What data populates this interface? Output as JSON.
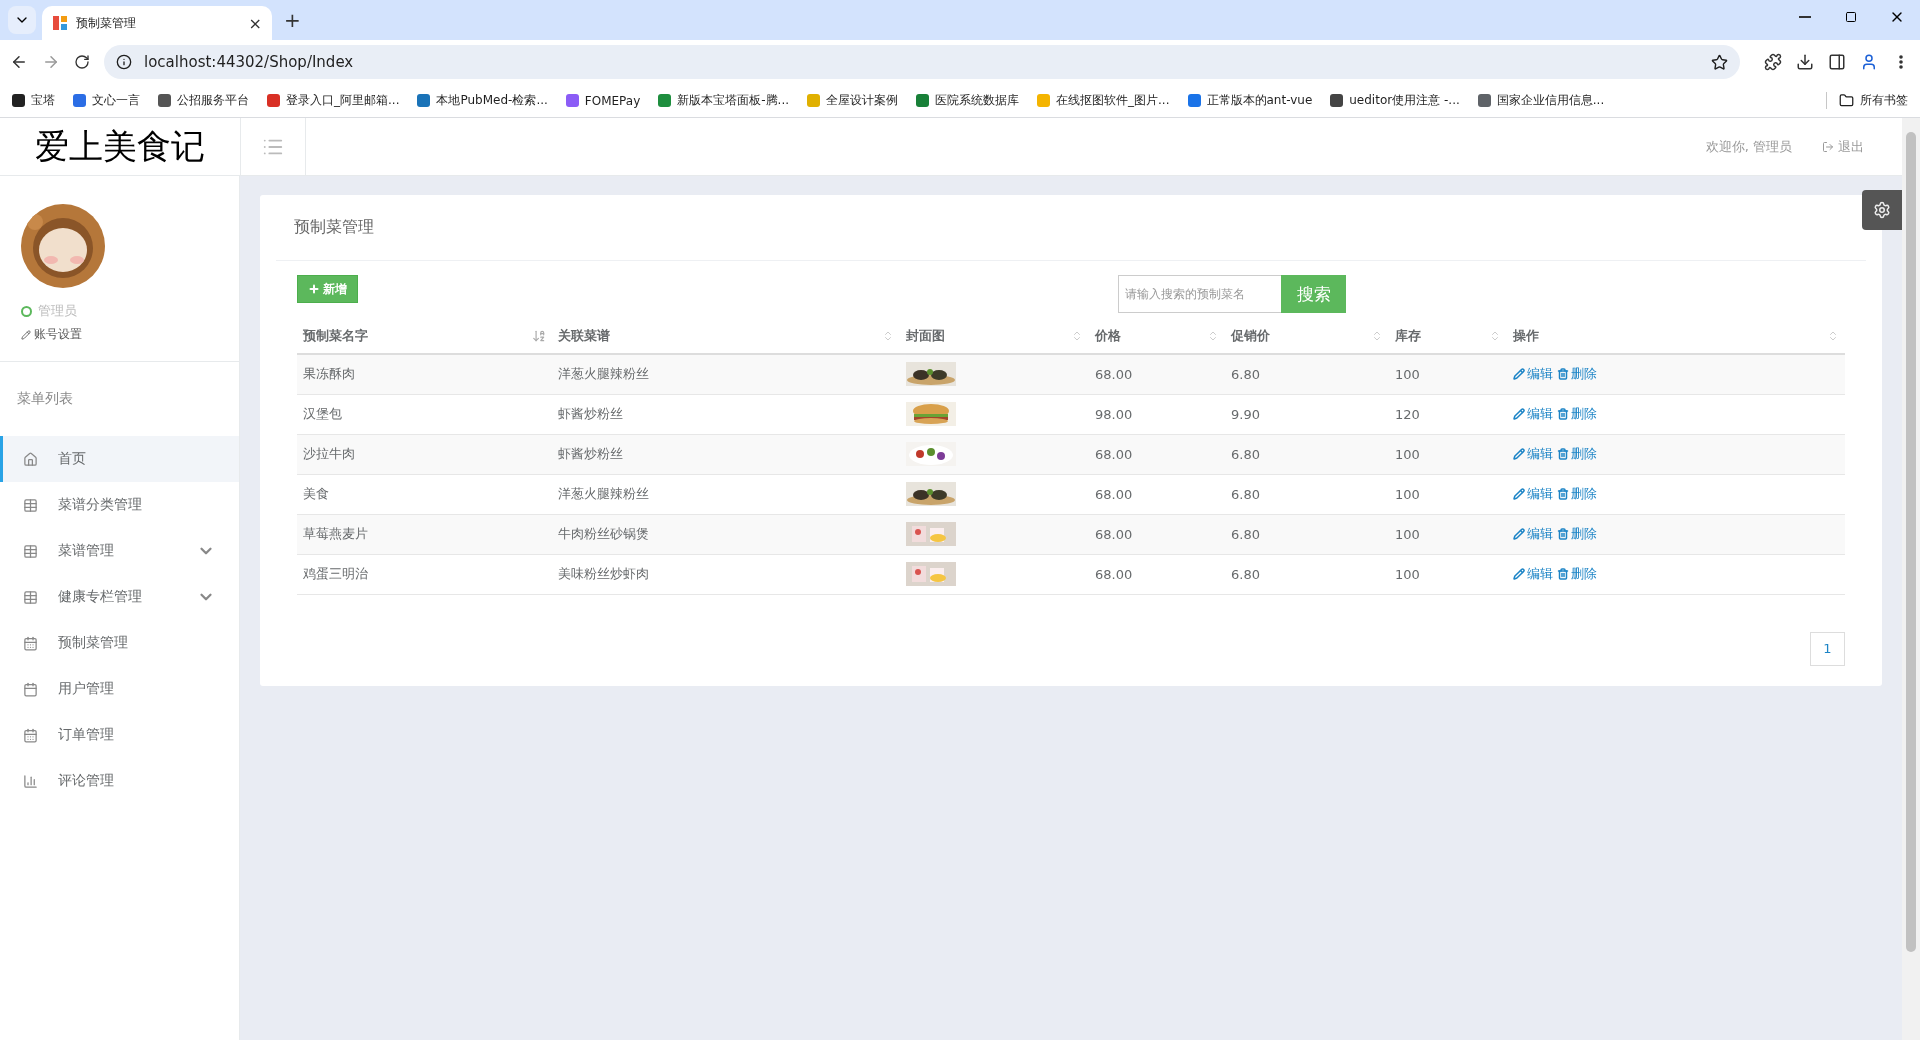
{
  "browser": {
    "tab": {
      "title": "预制菜管理",
      "close": "×"
    },
    "new_tab": "+",
    "url": "localhost:44302/Shop/Index",
    "bookmarks": [
      {
        "label": "宝塔",
        "color": "#222222"
      },
      {
        "label": "文心一言",
        "color": "#2b6de5"
      },
      {
        "label": "公招服务平台",
        "color": "#555555"
      },
      {
        "label": "登录入口_阿里邮箱...",
        "color": "#d93025"
      },
      {
        "label": "本地PubMed-检索...",
        "color": "#1a73b8"
      },
      {
        "label": "FOMEPay",
        "color": "#8b5cf6"
      },
      {
        "label": "新版本宝塔面板-腾...",
        "color": "#1e8e3e"
      },
      {
        "label": "全屋设计案例",
        "color": "#e0b000"
      },
      {
        "label": "医院系统数据库",
        "color": "#188038"
      },
      {
        "label": "在线抠图软件_图片...",
        "color": "#f4b400"
      },
      {
        "label": "正常版本的ant-vue",
        "color": "#1a73e8"
      },
      {
        "label": "ueditor使用注意 -...",
        "color": "#444444"
      },
      {
        "label": "国家企业信用信息...",
        "color": "#5f6368"
      }
    ],
    "all_bookmarks": "所有书签"
  },
  "app": {
    "logo": "爱上美食记",
    "welcome": "欢迎你, 管理员",
    "logout": "退出"
  },
  "profile": {
    "role": "管理员",
    "settings": "账号设置"
  },
  "sidebar": {
    "heading": "菜单列表",
    "items": [
      {
        "label": "首页",
        "selected": true,
        "expandable": false
      },
      {
        "label": "菜谱分类管理",
        "selected": false,
        "expandable": false
      },
      {
        "label": "菜谱管理",
        "selected": false,
        "expandable": true
      },
      {
        "label": "健康专栏管理",
        "selected": false,
        "expandable": true
      },
      {
        "label": "预制菜管理",
        "selected": false,
        "expandable": false
      },
      {
        "label": "用户管理",
        "selected": false,
        "expandable": false
      },
      {
        "label": "订单管理",
        "selected": false,
        "expandable": false
      },
      {
        "label": "评论管理",
        "selected": false,
        "expandable": false
      }
    ]
  },
  "panel": {
    "title": "预制菜管理",
    "add_button": "新增",
    "search": {
      "placeholder": "请输入搜索的预制菜名",
      "button": "搜索"
    }
  },
  "table": {
    "columns": [
      {
        "label": "预制菜名字",
        "sorted": true
      },
      {
        "label": "关联菜谱",
        "sorted": false
      },
      {
        "label": "封面图",
        "sorted": false
      },
      {
        "label": "价格",
        "sorted": false
      },
      {
        "label": "促销价",
        "sorted": false
      },
      {
        "label": "库存",
        "sorted": false
      },
      {
        "label": "操作",
        "sorted": false
      }
    ],
    "rows": [
      {
        "name": "果冻酥肉",
        "recipe": "洋葱火腿辣粉丝",
        "price": "68.00",
        "promo": "6.80",
        "stock": "100",
        "edit": "编辑",
        "delete": "删除"
      },
      {
        "name": "汉堡包",
        "recipe": "虾酱炒粉丝",
        "price": "98.00",
        "promo": "9.90",
        "stock": "120",
        "edit": "编辑",
        "delete": "删除"
      },
      {
        "name": "沙拉牛肉",
        "recipe": "虾酱炒粉丝",
        "price": "68.00",
        "promo": "6.80",
        "stock": "100",
        "edit": "编辑",
        "delete": "删除"
      },
      {
        "name": "美食",
        "recipe": "洋葱火腿辣粉丝",
        "price": "68.00",
        "promo": "6.80",
        "stock": "100",
        "edit": "编辑",
        "delete": "删除"
      },
      {
        "name": "草莓燕麦片",
        "recipe": "牛肉粉丝砂锅煲",
        "price": "68.00",
        "promo": "6.80",
        "stock": "100",
        "edit": "编辑",
        "delete": "删除"
      },
      {
        "name": "鸡蛋三明治",
        "recipe": "美味粉丝炒虾肉",
        "price": "68.00",
        "promo": "6.80",
        "stock": "100",
        "edit": "编辑",
        "delete": "删除"
      }
    ]
  },
  "pagination": [
    {
      "label": "1",
      "selected": true
    }
  ]
}
